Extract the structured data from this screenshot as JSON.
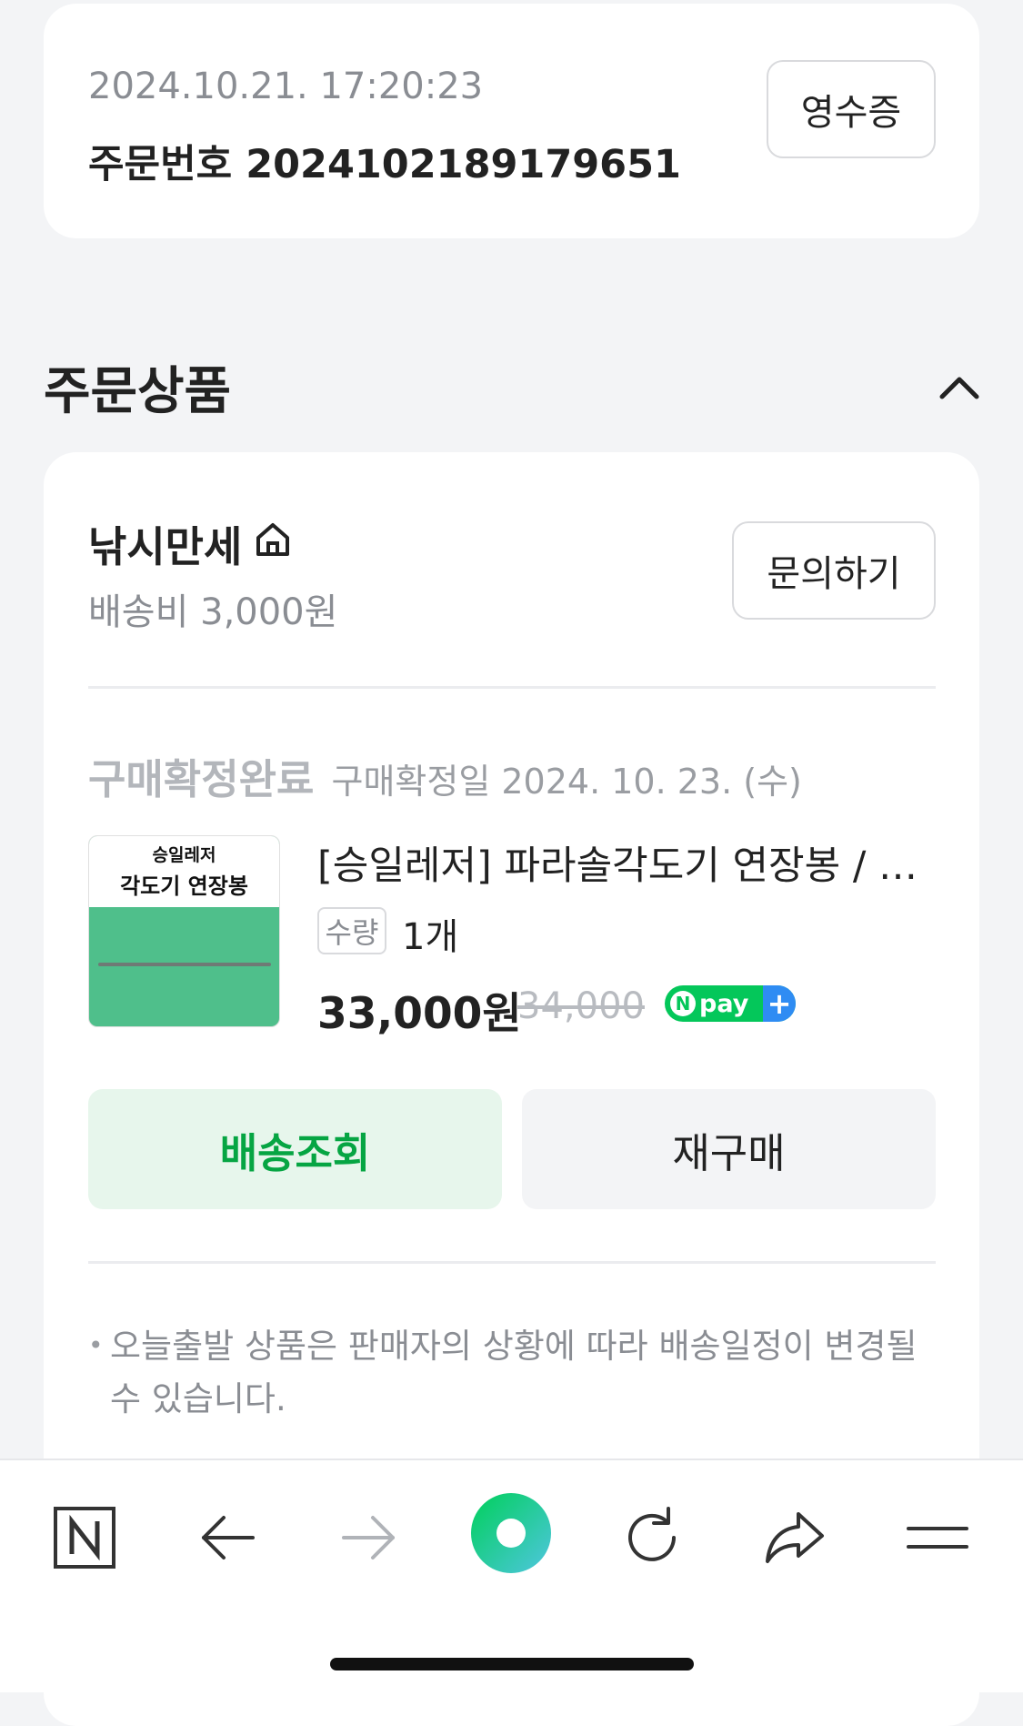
{
  "order": {
    "datetime": "2024.10.21. 17:20:23",
    "order_number": "주문번호 2024102189179651",
    "receipt_label": "영수증"
  },
  "section": {
    "title": "주문상품"
  },
  "seller": {
    "name": "낚시만세",
    "shipping_fee": "배송비 3,000원",
    "inquiry_label": "문의하기"
  },
  "item": {
    "status": "구매확정완료",
    "confirm_date": "구매확정일 2024. 10. 23. (수)",
    "thumbnail": {
      "brand": "승일레저",
      "title": "각도기 연장봉"
    },
    "name": "[승일레저] 파라솔각도기 연장봉 / 낚시파라솔",
    "qty_label": "수량",
    "qty_value": "1개",
    "price": "33,000원",
    "original_price": "34,000",
    "npay_text": "pay"
  },
  "actions": {
    "track_label": "배송조회",
    "rebuy_label": "재구매"
  },
  "notice": {
    "text": "오늘출발 상품은 판매자의 상황에 따라 배송일정이 변경될 수 있습니다."
  },
  "bottom_nav": {
    "icons": [
      "naver-n-icon",
      "back-arrow-icon",
      "forward-arrow-icon",
      "green-dot-icon",
      "refresh-icon",
      "share-icon",
      "menu-icon"
    ]
  },
  "colors": {
    "accent_green": "#06a543",
    "accent_green_bg": "#e7f6ec",
    "npay_green": "#04c75a",
    "npay_blue": "#2f8cf3",
    "page_bg": "#f3f4f6"
  }
}
